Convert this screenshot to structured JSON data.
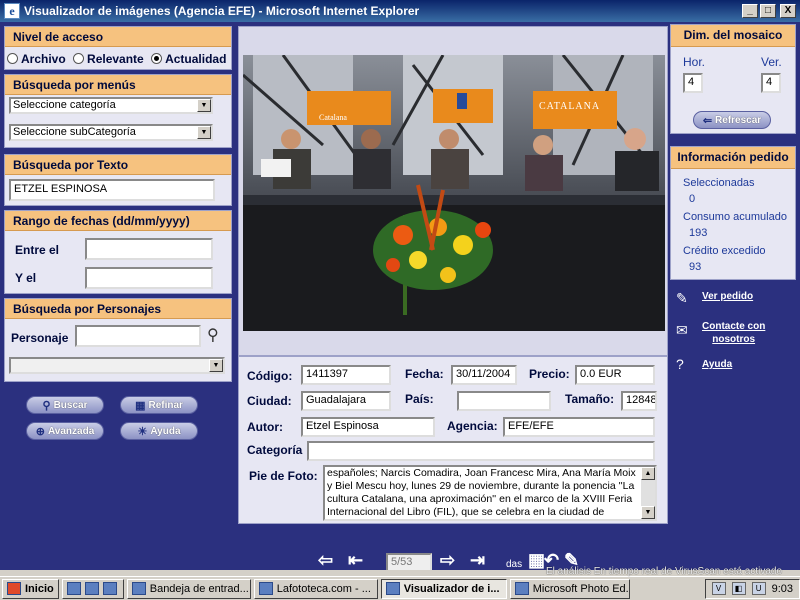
{
  "window": {
    "title": "Visualizador de imágenes (Agencia EFE) - Microsoft Internet Explorer",
    "controls": {
      "minimize": "_",
      "maximize": "□",
      "close": "X"
    }
  },
  "left": {
    "acceso": {
      "header": "Nivel de acceso",
      "options": [
        "Archivo",
        "Relevante",
        "Actualidad"
      ],
      "selected": "Actualidad"
    },
    "menus": {
      "header": "Búsqueda por menús",
      "categoria": "Seleccione categoría",
      "subcategoria": "Seleccione subCategoría"
    },
    "texto": {
      "header": "Búsqueda por Texto",
      "value": "ETZEL ESPINOSA"
    },
    "fechas": {
      "header": "Rango de fechas (dd/mm/yyyy)",
      "entre": "Entre el",
      "yel": "Y el",
      "entre_value": "",
      "yel_value": ""
    },
    "personajes": {
      "header": "Búsqueda por Personajes",
      "label": "Personaje",
      "value": "",
      "select_value": ""
    },
    "buttons": {
      "buscar": "Buscar",
      "refinar": "Refinar",
      "avanzada": "Avanzada",
      "ayuda": "Ayuda"
    }
  },
  "meta": {
    "codigo_label": "Código:",
    "codigo": "1411397",
    "fecha_label": "Fecha:",
    "fecha": "30/11/2004",
    "precio_label": "Precio:",
    "precio": "0.0 EUR",
    "ciudad_label": "Ciudad:",
    "ciudad": "Guadalajara",
    "pais_label": "País:",
    "pais": "",
    "tamano_label": "Tamaño:",
    "tamano": "12848",
    "autor_label": "Autor:",
    "autor": "Etzel Espinosa",
    "agencia_label": "Agencia:",
    "agencia": "EFE/EFE",
    "categoria_label": "Categoría",
    "categoria": "",
    "pie_label": "Pie de Foto:",
    "pie": "españoles; Narcis Comadira, Joan Francesc Mira, Ana María Moix y Biel Mescu hoy, lunes 29 de noviembre, durante la ponencia ''La cultura Catalana, una aproximación'' en el marco de la XVIII Feria Internacional del Libro (FIL), que se celebra en la ciudad de"
  },
  "nav": {
    "page": "5/53",
    "das": "das"
  },
  "photo": {
    "banner_left": "Catalana",
    "banner_right": "CATALANA"
  },
  "right": {
    "mosaico": {
      "header": "Dim. del mosaico",
      "hor_label": "Hor.",
      "ver_label": "Ver.",
      "hor": "4",
      "ver": "4",
      "refrescar": "Refrescar"
    },
    "pedido": {
      "header": "Información pedido",
      "sel_label": "Seleccionadas",
      "sel": "0",
      "consumo_label": "Consumo acumulado",
      "consumo": "193",
      "credito_label": "Crédito excedido",
      "credito": "93"
    },
    "links": {
      "ver_pedido": "Ver pedido",
      "contacte": "Contacte con",
      "nosotros": "nosotros",
      "ayuda": "Ayuda"
    }
  },
  "status": {
    "virus": "El análisis En tiempo real de VirusScan está activado"
  },
  "taskbar": {
    "start": "Inicio",
    "tasks": [
      "Bandeja de entrad...",
      "Lafototeca.com - ...",
      "Visualizador de i...",
      "Microsoft Photo Ed..."
    ],
    "clock": "9:03"
  },
  "colors": {
    "panel_bg": "#2b307f",
    "header_orange": "#f6c27f",
    "section_bg": "#e7e7f3"
  }
}
